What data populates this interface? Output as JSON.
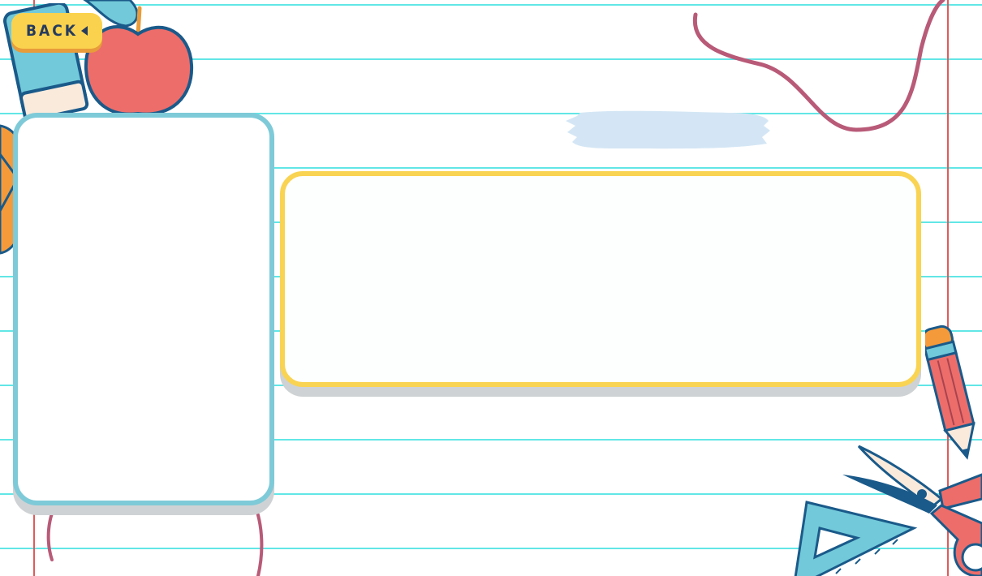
{
  "back_button": {
    "label": "BACK"
  },
  "colors": {
    "paper": "#ffffff",
    "rule_line": "#62e6e6",
    "margin_line": "#e05a5a",
    "left_panel_border": "#7ecad8",
    "main_panel_border": "#f9d352",
    "button": "#fbd24e",
    "button_text": "#253b5e"
  },
  "icons": [
    "eraser-icon",
    "apple-icon",
    "leaf-icon",
    "pencil-icon",
    "scissors-icon",
    "set-square-icon",
    "paint-stroke-icon",
    "string-doodle-icon"
  ]
}
